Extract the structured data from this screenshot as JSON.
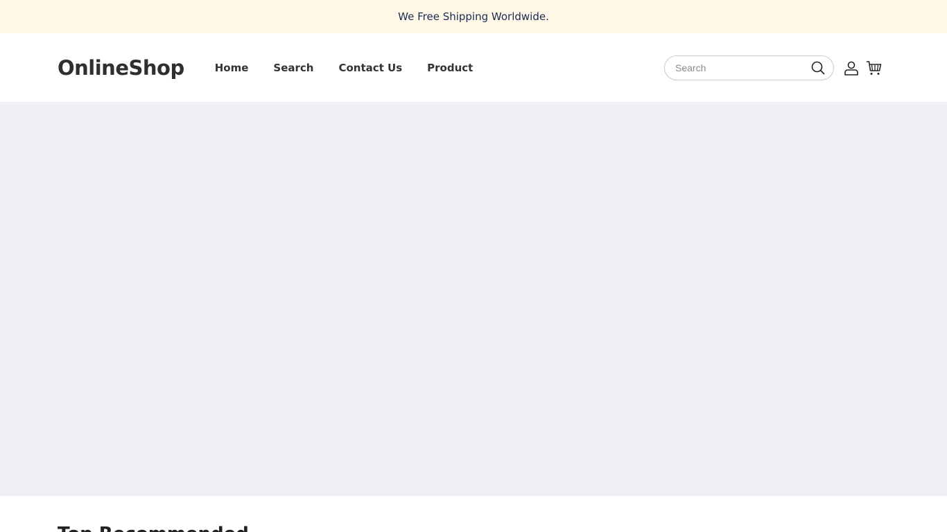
{
  "announcement": {
    "text": "We Free Shipping Worldwide."
  },
  "header": {
    "logo": "OnlineShop",
    "nav": [
      {
        "label": "Home"
      },
      {
        "label": "Search"
      },
      {
        "label": "Contact Us"
      },
      {
        "label": "Product"
      }
    ],
    "search": {
      "placeholder": "Search",
      "value": ""
    },
    "icons": {
      "search": "search-icon",
      "account": "user-icon",
      "cart": "cart-icon"
    }
  },
  "hero": {
    "background": "#eef0f5"
  },
  "section": {
    "title": "Top Recommended"
  },
  "colors": {
    "announcement_bg": "#fff8e6",
    "announcement_text": "#1b2a55",
    "text_dark": "#333333"
  }
}
